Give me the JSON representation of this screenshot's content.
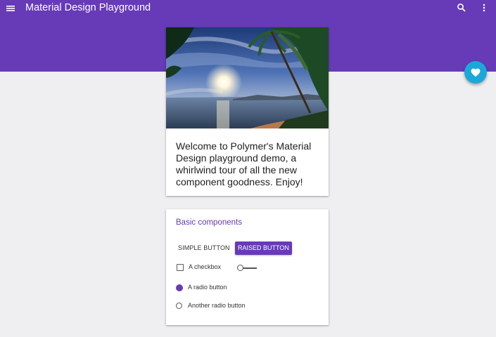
{
  "appbar": {
    "title": "Material Design Playground",
    "color": "#673ab7",
    "icons": [
      "menu-icon",
      "search-icon",
      "more-vert-icon"
    ]
  },
  "fab": {
    "icon": "heart-icon",
    "color": "#1aa8d8"
  },
  "welcome_card": {
    "image": "tropical-beach-sunset-photo",
    "text": "Welcome to Polymer's Material Design playground demo, a whirlwind tour of all the new component goodness. Enjoy!"
  },
  "components_card": {
    "heading": "Basic components",
    "simple_button_label": "SIMPLE BUTTON",
    "raised_button_label": "RAISED BUTTON",
    "checkbox_label": "A checkbox",
    "checkbox_checked": false,
    "toggle_on": false,
    "radio_selected_label": "A radio button",
    "radio_other_label": "Another radio button",
    "accent": "#673ab7"
  }
}
